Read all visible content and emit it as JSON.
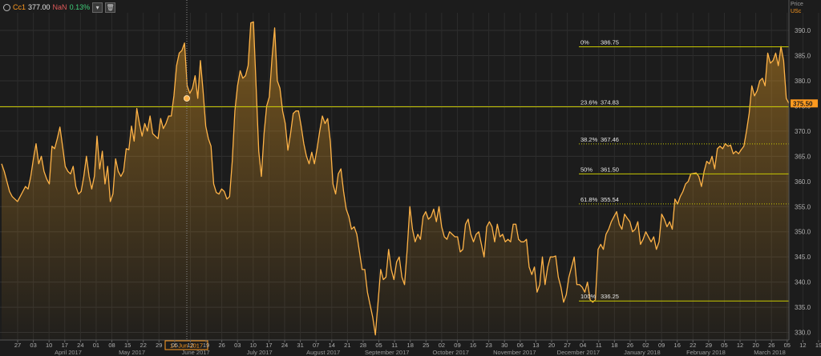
{
  "legend": {
    "symbol": "Cc1",
    "last": "377.00",
    "change": "NaN",
    "pct": "0.13%"
  },
  "axis_header": {
    "title": "Price",
    "currency": "USc"
  },
  "chart_data": {
    "type": "area",
    "title": "",
    "xlabel": "",
    "ylabel": "Price",
    "ylim": [
      328.5,
      393.5
    ],
    "yticks": [
      330.0,
      335.0,
      340.0,
      345.0,
      350.0,
      355.0,
      360.0,
      365.0,
      370.0,
      375.0,
      380.0,
      385.0,
      390.0
    ],
    "grid": true,
    "color": "#f5a623",
    "line_color": "#ffb347",
    "last_price_label": "375.50",
    "crosshair_date": "14 Jun 2017",
    "crosshair_value": 376.5,
    "x_tick_labels": [
      "27",
      "03",
      "10",
      "17",
      "24",
      "01",
      "08",
      "15",
      "22",
      "29",
      "05",
      "12",
      "19",
      "26",
      "03",
      "10",
      "17",
      "24",
      "31",
      "07",
      "14",
      "21",
      "28",
      "05",
      "11",
      "18",
      "25",
      "02",
      "09",
      "16",
      "23",
      "30",
      "06",
      "13",
      "20",
      "27",
      "04",
      "11",
      "18",
      "26",
      "02",
      "09",
      "16",
      "22",
      "29",
      "05",
      "12",
      "20",
      "26",
      "05",
      "12",
      "19"
    ],
    "month_labels": [
      "April 2017",
      "May 2017",
      "June 2017",
      "July 2017",
      "August 2017",
      "September 2017",
      "October 2017",
      "November 2017",
      "December 2017",
      "January 2018",
      "February 2018",
      "March 2018"
    ],
    "fibonacci": [
      {
        "label": "0%",
        "value": 386.75,
        "text": "386.75",
        "style": "solid"
      },
      {
        "label": "23.6%",
        "value": 374.83,
        "text": "374.83",
        "style": "solid"
      },
      {
        "label": "38.2%",
        "value": 367.46,
        "text": "367.46",
        "style": "dotted"
      },
      {
        "label": "50%",
        "value": 361.5,
        "text": "361.50",
        "style": "solid"
      },
      {
        "label": "61.8%",
        "value": 355.54,
        "text": "355.54",
        "style": "dotted"
      },
      {
        "label": "100%",
        "value": 336.25,
        "text": "336.25",
        "style": "solid"
      }
    ],
    "values": [
      363.5,
      362,
      360,
      358,
      357,
      356.5,
      356,
      357,
      358,
      359,
      358.5,
      361,
      364.5,
      367.5,
      363.5,
      365,
      362,
      360.5,
      359.5,
      367,
      366.5,
      368.5,
      370.8,
      367,
      363,
      362,
      361.5,
      363,
      359,
      357.5,
      358,
      361,
      365,
      361,
      358.5,
      361,
      369,
      362.5,
      366,
      359.5,
      363,
      356,
      357.5,
      364.5,
      362,
      361,
      362,
      366.5,
      366.3,
      371,
      368,
      374.5,
      371.5,
      369,
      371.5,
      370,
      373,
      369.5,
      369,
      368.5,
      372.5,
      370.5,
      371.5,
      373,
      373,
      377,
      383,
      385.5,
      386,
      387.5,
      379,
      377.5,
      378.5,
      381,
      376.5,
      384,
      378,
      371,
      368.5,
      367,
      359.5,
      357.8,
      357.5,
      358.5,
      358,
      356.5,
      357,
      364,
      374,
      379,
      382,
      380.5,
      381,
      383,
      391.5,
      391.7,
      379,
      366,
      361,
      369.5,
      375,
      376.8,
      384.5,
      390.5,
      380,
      378.5,
      374,
      371.5,
      366.2,
      369.5,
      373.5,
      374,
      374,
      371,
      367.5,
      365,
      363.5,
      365.8,
      363.5,
      366.5,
      370,
      373,
      371.5,
      372.5,
      368,
      359.5,
      357.5,
      361.5,
      362.5,
      358,
      354.5,
      353,
      350.5,
      351,
      349.5,
      346,
      342.5,
      342.5,
      338,
      335.5,
      333,
      329.5,
      336,
      342.5,
      340.5,
      341,
      346.5,
      342.5,
      340.5,
      344,
      345,
      341,
      339.5,
      346.5,
      355,
      350.5,
      348,
      349.5,
      348.5,
      353,
      354,
      352.5,
      353,
      354.5,
      352,
      355,
      351,
      349,
      348.5,
      350,
      349.5,
      349,
      349,
      346,
      346.5,
      351.5,
      352.5,
      349.5,
      348,
      349.5,
      350,
      347.5,
      345,
      351,
      352,
      351,
      348,
      351.5,
      349,
      349.5,
      348,
      348.5,
      348,
      351.5,
      351.5,
      348.5,
      348,
      348,
      348.5,
      343,
      341.5,
      343,
      338,
      339.5,
      345,
      339.5,
      343,
      345,
      345,
      345.2,
      341,
      339,
      336,
      337.5,
      341,
      343,
      345,
      339.5,
      339.5,
      339,
      338,
      340,
      336.5,
      336,
      336.5,
      346.5,
      347.5,
      346.5,
      349.5,
      350.5,
      352,
      353,
      354,
      351.5,
      350.5,
      353.5,
      352.7,
      352,
      350,
      350.5,
      352,
      347.5,
      348.5,
      350,
      349,
      348,
      349,
      346.5,
      348,
      353.5,
      352.5,
      351,
      352,
      350.5,
      356.5,
      355.5,
      357,
      358,
      359.5,
      360,
      361.5,
      361.6,
      361.7,
      361,
      359,
      362,
      364,
      363.5,
      365,
      362.5,
      366.5,
      367,
      366.5,
      367.5,
      367,
      367.2,
      365.5,
      366,
      365.5,
      366.3,
      367,
      370,
      373.5,
      379,
      377,
      378,
      380,
      380.5,
      379,
      385.5,
      383.5,
      384,
      385.5,
      383,
      386.8,
      384,
      376.5,
      375.5
    ]
  }
}
